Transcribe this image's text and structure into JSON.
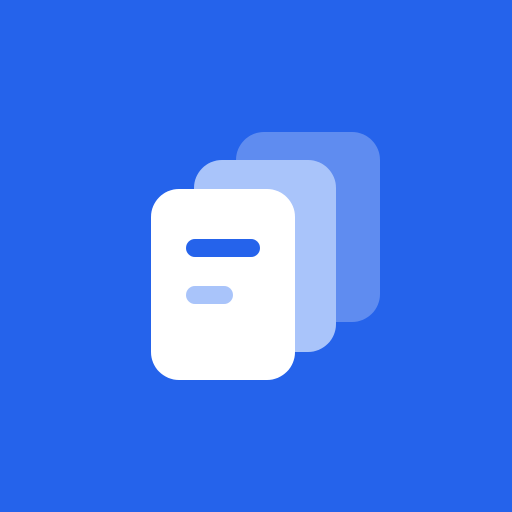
{
  "app_icon": {
    "icon_name": "stacked-documents-icon",
    "colors": {
      "background": "#2563eb",
      "back_card": "#5f8cf0",
      "middle_card": "#a9c4fa",
      "front_card": "#ffffff",
      "title_line": "#2563eb",
      "subtitle_line": "#a9c4fa"
    }
  }
}
